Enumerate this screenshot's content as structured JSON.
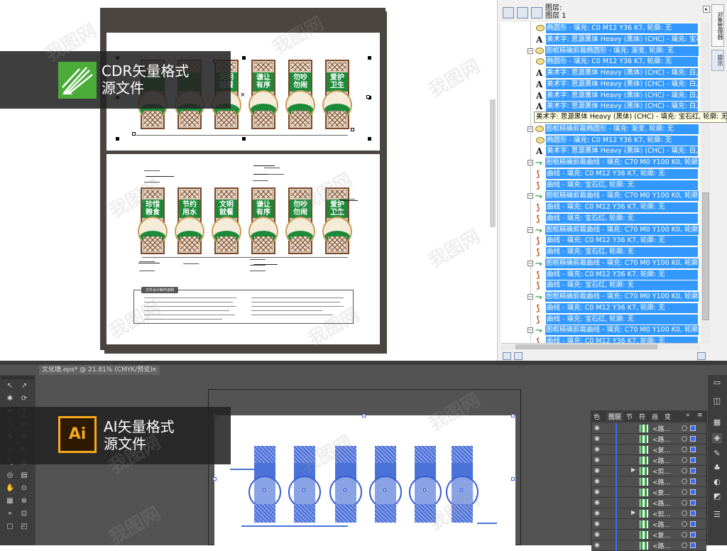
{
  "cdr": {
    "badge_line1": "CDR矢量格式",
    "badge_line2": "源文件",
    "sheet1_titles": [
      "",
      "",
      "文明\n就餐",
      "谦让\n有序",
      "勿吵\n勿闹",
      "爱护\n卫生"
    ],
    "sheet2_titles": [
      "珍惜\n粮食",
      "节约\n用水",
      "文明\n就餐",
      "谦让\n有序",
      "勿吵\n勿闹",
      "爱护\n卫生"
    ],
    "info_heading": "文件设计制作说明"
  },
  "layers_panel": {
    "title_line1": "图层:",
    "title_line2": "图层 1",
    "side_tab_1": "对象管理器",
    "side_tab_2": "提示",
    "tooltip": "美术字: 思源黑体 Heavy (黑体) (CHC) - 填充: 宝石红, 轮廓: 无",
    "rows": [
      {
        "icon": "ellipse",
        "indent": 1,
        "text": "椭圆形 - 填充: C0 M12 Y36 K7, 轮廓: 无"
      },
      {
        "icon": "text",
        "indent": 1,
        "text": "美术字: 思源黑体 Heavy (黑体) (CHC) - 填充: 宝石"
      },
      {
        "icon": "ellipse",
        "indent": 0,
        "expand": true,
        "text": "图框精确剪裁椭圆形 - 填充: 渐变, 轮廓: 无"
      },
      {
        "icon": "ellipse",
        "indent": 1,
        "text": "椭圆形 - 填充: C0 M12 Y36 K7, 轮廓: 无"
      },
      {
        "icon": "text",
        "indent": 1,
        "text": "美术字: 思源黑体 Heavy (黑体) (CHC) - 填充: 白,"
      },
      {
        "icon": "text",
        "indent": 1,
        "text": "美术字: 思源黑体 Heavy (黑体) (CHC) - 填充: 白,"
      },
      {
        "icon": "text",
        "indent": 1,
        "text": "美术字: 思源黑体 Heavy (黑体) (CHC) - 填充: 白,"
      },
      {
        "icon": "text",
        "indent": 1,
        "text": "美术字: 思源黑体 Heavy (黑体) (CHC) - 填充: 白,"
      },
      {
        "icon": "text",
        "indent": 1,
        "text": ""
      },
      {
        "icon": "ellipse",
        "indent": 0,
        "expand": true,
        "text": "图框精确剪裁椭圆形 - 填充: 渐变, 轮廓: 无"
      },
      {
        "icon": "ellipse",
        "indent": 1,
        "text": "椭圆形 - 填充: C0 M12 Y36 K7, 轮廓: 无"
      },
      {
        "icon": "text",
        "indent": 1,
        "text": "美术字: 思源黑体 Heavy (黑体) (CHC) - 填充: 白,"
      },
      {
        "icon": "curve",
        "indent": 0,
        "expand": true,
        "text": "图框精确剪裁曲线 - 填充: C70 M0 Y100 K0, 轮廓:"
      },
      {
        "icon": "curve2",
        "indent": 1,
        "text": "曲线 - 填充: C0 M12 Y36 K7, 轮廓: 无"
      },
      {
        "icon": "curve2",
        "indent": 1,
        "text": "曲线 - 填充: 宝石红, 轮廓: 无"
      },
      {
        "icon": "curve",
        "indent": 0,
        "expand": true,
        "text": "图框精确剪裁曲线 - 填充: C70 M0 Y100 K0, 轮廓:"
      },
      {
        "icon": "curve2",
        "indent": 1,
        "text": "曲线 - 填充: C0 M12 Y36 K7, 轮廓: 无"
      },
      {
        "icon": "curve2",
        "indent": 1,
        "text": "曲线 - 填充: 宝石红, 轮廓: 无"
      },
      {
        "icon": "curve",
        "indent": 0,
        "expand": true,
        "text": "图框精确剪裁曲线 - 填充: C70 M0 Y100 K0, 轮廓:"
      },
      {
        "icon": "curve2",
        "indent": 1,
        "text": "曲线 - 填充: C0 M12 Y36 K7, 轮廓: 无"
      },
      {
        "icon": "curve2",
        "indent": 1,
        "text": "曲线 - 填充: 宝石红, 轮廓: 无"
      },
      {
        "icon": "curve",
        "indent": 0,
        "expand": true,
        "text": "图框精确剪裁曲线 - 填充: C70 M0 Y100 K0, 轮廓:"
      },
      {
        "icon": "curve2",
        "indent": 1,
        "text": "曲线 - 填充: C0 M12 Y36 K7, 轮廓: 无"
      },
      {
        "icon": "curve2",
        "indent": 1,
        "text": "曲线 - 填充: 宝石红, 轮廓: 无"
      },
      {
        "icon": "curve",
        "indent": 0,
        "expand": true,
        "text": "图框精确剪裁曲线 - 填充: C70 M0 Y100 K0, 轮廓:"
      },
      {
        "icon": "curve2",
        "indent": 1,
        "text": "曲线 - 填充: C0 M12 Y36 K7, 轮廓: 无"
      },
      {
        "icon": "curve2",
        "indent": 1,
        "text": "曲线 - 填充: 宝石红, 轮廓: 无"
      },
      {
        "icon": "curve",
        "indent": 0,
        "expand": true,
        "text": "图框精确剪裁曲线 - 填充: C70 M0 Y100 K0, 轮廓:"
      },
      {
        "icon": "curve2",
        "indent": 1,
        "text": "曲线 - 填充: C0 M12 Y36 K7, 轮廓: 无"
      }
    ]
  },
  "ai": {
    "doc_tab": "文化墙.eps* @ 21.81% (CMYK/预览)",
    "badge_line1": "AI矢量格式",
    "badge_line2": "源文件",
    "layers_tab_1": "色",
    "layers_tab_2": "图层",
    "layers_tab_3": "节",
    "layers_tab_4": "符",
    "layers_tab_5": "画",
    "layers_tab_6": "变",
    "layer_rows": [
      {
        "name": "<路...",
        "arrow": false
      },
      {
        "name": "<路...",
        "arrow": false
      },
      {
        "name": "<复...",
        "arrow": false
      },
      {
        "name": "<路...",
        "arrow": false
      },
      {
        "name": "<剪...",
        "arrow": true
      },
      {
        "name": "<路...",
        "arrow": false
      },
      {
        "name": "<复...",
        "arrow": false
      },
      {
        "name": "<路...",
        "arrow": false
      },
      {
        "name": "<剪...",
        "arrow": true
      },
      {
        "name": "<路...",
        "arrow": false
      },
      {
        "name": "<复...",
        "arrow": false
      },
      {
        "name": "<路...",
        "arrow": false
      }
    ]
  },
  "watermark": "我图网",
  "colors": {
    "cdr_green": "#4bac39",
    "ai_orange": "#f7a81b",
    "selection_blue": "#3399ff",
    "ai_selection": "#3a6af0"
  }
}
